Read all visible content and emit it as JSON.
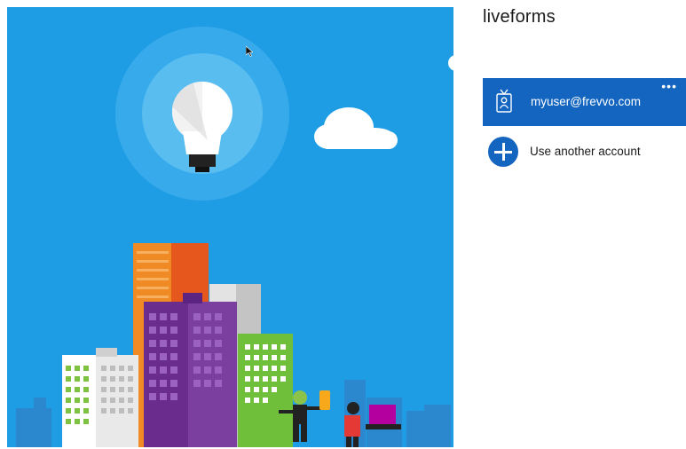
{
  "window": {
    "app_title": "liveforms"
  },
  "accounts": {
    "selected_account_email": "myuser@frevvo.com",
    "selected_account_icon": "badge-icon",
    "more_options_icon": "ellipsis-icon",
    "more_options_label": "•••",
    "another_account_label": "Use another account",
    "another_account_icon": "plus-circle-icon"
  },
  "hero": {
    "illustration": "city-skyline-lightbulb",
    "background_color": "#1e9de4"
  },
  "colors": {
    "accent": "#1465c0",
    "panel_bg": "#ffffff"
  }
}
